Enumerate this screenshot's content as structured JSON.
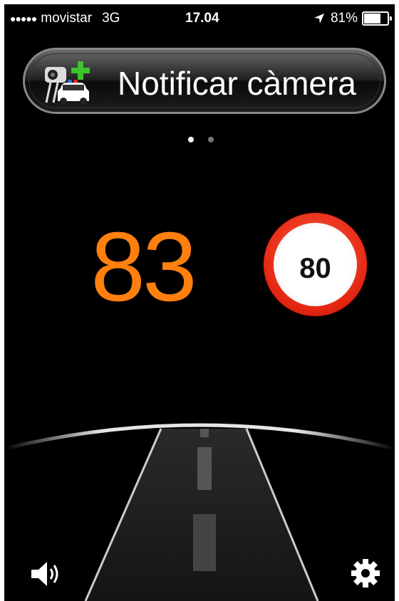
{
  "status_bar": {
    "signal_dots": "●●●●●",
    "carrier": "movistar",
    "network": "3G",
    "time": "17.04",
    "battery_text": "81%",
    "battery_level": 0.81
  },
  "report_button": {
    "label": "Notificar càmera",
    "icon": "speed-camera-add-icon"
  },
  "pager": {
    "total": 2,
    "active": 0
  },
  "current_speed": "83",
  "speed_limit": "80",
  "colors": {
    "speed": "#ff7f0f",
    "limit_ring": "#e32512",
    "add_plus": "#3cc42c"
  },
  "toolbar": {
    "sound_icon": "speaker-icon",
    "settings_icon": "gear-icon"
  }
}
